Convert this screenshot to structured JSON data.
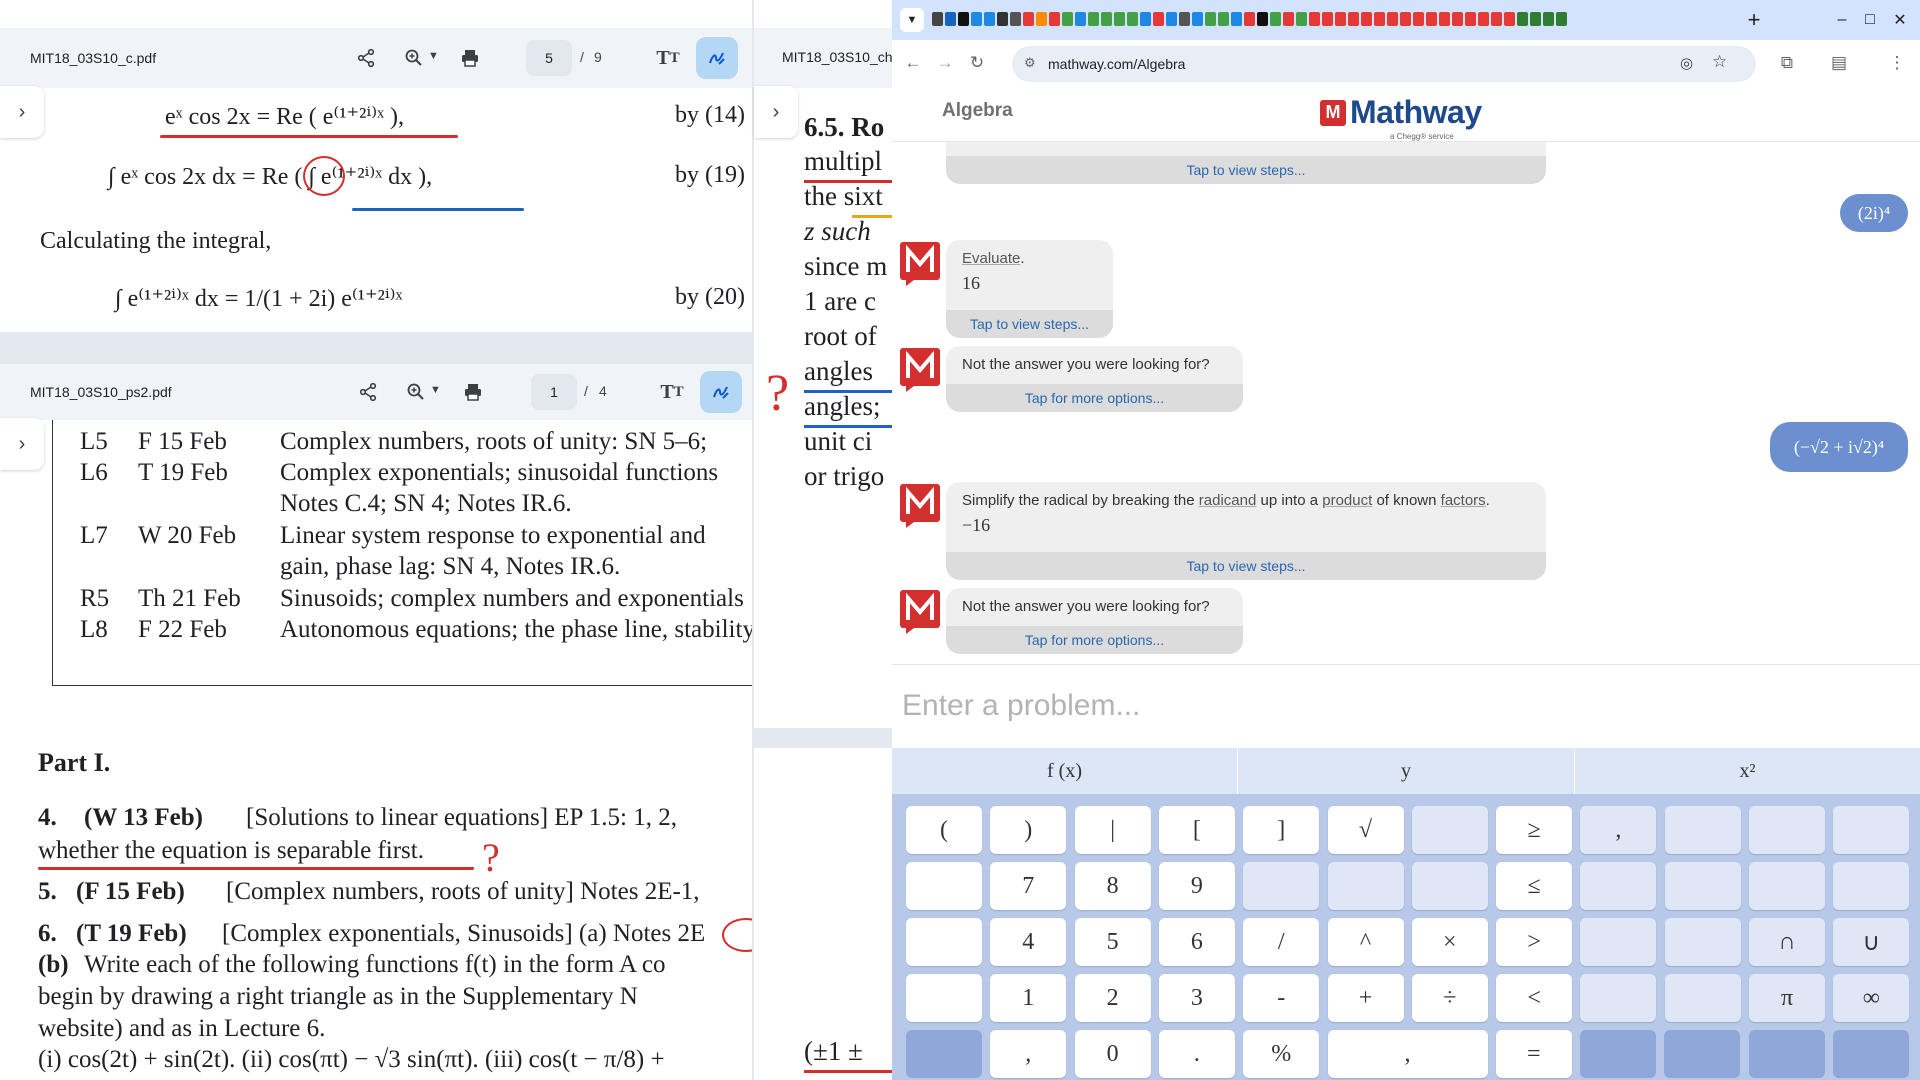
{
  "pdf_top": {
    "filename": "MIT18_03S10_c.pdf",
    "page_current": "5",
    "page_sep": "/",
    "page_total": "9",
    "lines": [
      {
        "expr": "eˣ cos 2x  =  Re ( e⁽¹⁺²ⁱ⁾ˣ ),",
        "ref": "by (14)"
      },
      {
        "expr": "∫ eˣ cos 2x dx  =  Re ( ∫ e⁽¹⁺²ⁱ⁾ˣ dx ),",
        "ref": "by (19)"
      },
      {
        "text": "Calculating the integral,"
      },
      {
        "expr": "∫ e⁽¹⁺²ⁱ⁾ˣ dx  =  1/(1 + 2i) e⁽¹⁺²ⁱ⁾ˣ",
        "ref": "by (20)"
      }
    ]
  },
  "pdf_bottom": {
    "filename": "MIT18_03S10_ps2.pdf",
    "page_current": "1",
    "page_sep": "/",
    "page_total": "4",
    "schedule": [
      {
        "lec": "L5",
        "date": "F 15 Feb",
        "topic": "Complex numbers, roots of unity: SN 5–6;"
      },
      {
        "lec": "L6",
        "date": "T 19 Feb",
        "topic": "Complex exponentials; sinusoidal functions"
      },
      {
        "lec": "",
        "date": "",
        "topic": "Notes C.4; SN 4; Notes IR.6."
      },
      {
        "lec": "L7",
        "date": "W 20 Feb",
        "topic": "Linear system response to exponential and"
      },
      {
        "lec": "",
        "date": "",
        "topic": "gain, phase lag: SN 4, Notes IR.6."
      },
      {
        "lec": "R5",
        "date": "Th 21 Feb",
        "topic": "Sinusoids; complex numbers and exponentials"
      },
      {
        "lec": "L8",
        "date": "F 22 Feb",
        "topic": "Autonomous equations; the phase line, stability"
      }
    ],
    "part_heading": "Part I.",
    "problems": [
      {
        "num": "4.",
        "head": "(W 13 Feb)",
        "text": "[Solutions to linear equations] EP 1.5: 1, 2,"
      },
      {
        "num": "",
        "head": "",
        "text": "whether the equation is separable first."
      },
      {
        "num": "5.",
        "head": "(F 15 Feb)",
        "text": "[Complex numbers, roots of unity] Notes 2E-1,"
      },
      {
        "num": "6.",
        "head": "(T 19 Feb)",
        "text": "[Complex exponentials, Sinusoids] (a) Notes 2E"
      },
      {
        "num": "",
        "head": "(b)",
        "text": "Write each of the following functions f(t) in the form A co"
      },
      {
        "num": "",
        "head": "",
        "text": "begin by drawing a right triangle as in the Supplementary N"
      },
      {
        "num": "",
        "head": "",
        "text": "website) and as in Lecture 6."
      },
      {
        "num": "",
        "head": "",
        "text": "(i) cos(2t) + sin(2t).  (ii) cos(πt) − √3 sin(πt).  (iii) cos(t − π/8) +"
      }
    ],
    "question_mark": "?"
  },
  "pdf_middle": {
    "filename": "MIT18_03S10_ch",
    "lines": [
      "6.5. Ro",
      "multipl",
      "the sixt",
      "z such",
      "since m",
      "1 are c",
      "root of",
      "angles",
      "angles;",
      "unit ci",
      "or trigo"
    ],
    "bottom_text": "(±1 ±",
    "question_mark": "?"
  },
  "browser": {
    "url": "mathway.com/Algebra",
    "new_tab": "+",
    "minimize": "–",
    "maximize": "□",
    "close": "✕"
  },
  "mathway": {
    "section": "Algebra",
    "logo_mark": "M",
    "logo_text": "Mathway",
    "logo_sub": "a Chegg® service",
    "top_partial_footer": "Tap to view steps...",
    "user_msg_1": "(2i)⁴",
    "bot_1": {
      "label": "Evaluate",
      "period": ".",
      "answer": "16",
      "footer": "Tap to view steps..."
    },
    "bot_2": {
      "text": "Not the answer you were looking for?",
      "footer": "Tap for more options..."
    },
    "user_msg_2": "(−√2 + i√2)⁴",
    "bot_3": {
      "pre": "Simplify the radical by breaking the ",
      "w1": "radicand",
      "mid1": " up into a ",
      "w2": "product",
      "mid2": " of known ",
      "w3": "factors",
      "end": ".",
      "answer": "−16",
      "footer": "Tap to view steps..."
    },
    "bot_4": {
      "text": "Not the answer you were looking for?",
      "footer": "Tap for more options..."
    },
    "input_placeholder": "Enter a problem...",
    "tabs": [
      "f (x)",
      "y",
      "x²"
    ],
    "keys": [
      [
        "(",
        ")",
        "|",
        "[",
        "]",
        "√",
        "",
        "≥",
        ",",
        "",
        "",
        ""
      ],
      [
        "",
        "7",
        "8",
        "9",
        "",
        "",
        "",
        "≤",
        "",
        "",
        "",
        ""
      ],
      [
        "",
        "4",
        "5",
        "6",
        "/",
        "^",
        "×",
        ">",
        "",
        "",
        "∩",
        "∪"
      ],
      [
        "",
        "1",
        "2",
        "3",
        "-",
        "+",
        "÷",
        "<",
        "",
        "",
        "π",
        "∞"
      ],
      [
        "",
        ",",
        "0",
        ".",
        "%",
        ",",
        "=",
        "",
        "",
        "",
        ""
      ]
    ]
  }
}
